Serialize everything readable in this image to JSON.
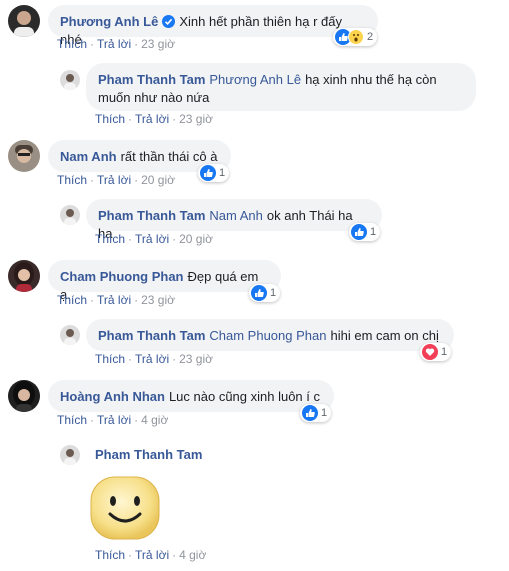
{
  "labels": {
    "like": "Thích",
    "reply": "Trả lời",
    "dot": "·"
  },
  "comments": [
    {
      "author": "Phương Anh Lê",
      "text": "Xinh hết phần thiên hạ r đấy nhé",
      "time": "23 giờ",
      "reactions": [
        "like-icon",
        "wow-icon"
      ],
      "count": "2",
      "verified": true,
      "reply": {
        "author": "Pham Thanh Tam",
        "tag": "Phương Anh Lê",
        "text": "hạ xinh nhu thế hạ còn muốn như nào nứa",
        "time": "23 giờ"
      }
    },
    {
      "author": "Nam Anh",
      "text": "rất thần thái cô à",
      "time": "20 giờ",
      "reactions": [
        "like-icon"
      ],
      "count": "1",
      "reply": {
        "author": "Pham Thanh Tam",
        "tag": "Nam Anh",
        "text": "ok anh Thái ha ha",
        "time": "20 giờ",
        "reactions": [
          "like-icon"
        ],
        "count": "1"
      }
    },
    {
      "author": "Cham Phuong Phan",
      "text": "Đẹp quá em ạ.",
      "time": "23 giờ",
      "reactions": [
        "like-icon"
      ],
      "count": "1",
      "reply": {
        "author": "Pham Thanh Tam",
        "tag": "Cham Phuong Phan",
        "text": "hihi em cam on chị",
        "time": "23 giờ",
        "reactions": [
          "love-icon"
        ],
        "count": "1"
      }
    },
    {
      "author": "Hoàng Anh Nhan",
      "text": "Luc nào cũng xinh luôn í c",
      "time": "4 giờ",
      "reactions": [
        "like-icon"
      ],
      "count": "1",
      "reply": {
        "author": "Pham Thanh Tam",
        "sticker": "smiley-sticker",
        "time": "4 giờ"
      }
    }
  ]
}
